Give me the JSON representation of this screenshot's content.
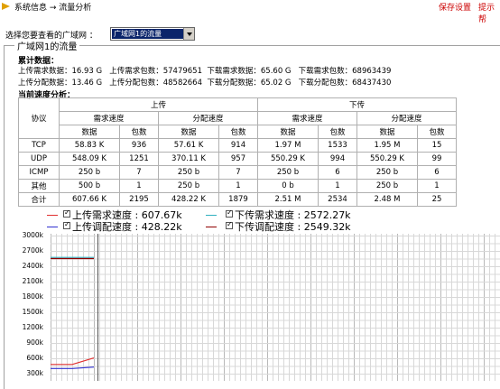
{
  "header": {
    "breadcrumb": "系统信息 → 流量分析",
    "save_label": "保存设置",
    "tip_label": "提示帮"
  },
  "selector": {
    "label": "选择您要查看的广域网 ：",
    "value": "广域网1的流量"
  },
  "panel": {
    "legend": "广域网1的流量",
    "cumulative_title": "累计数据：",
    "cumulative_lines": [
      "上传需求数据：16.93 G   上传需求包数：57479651  下载需求数据：65.60 G   下载需求包数：68963439",
      "上传分配数据：13.46 G   上传分配包数：48582664  下载分配数据：65.02 G   下载分配包数：68437430"
    ],
    "current_title": "当前速度分析："
  },
  "table": {
    "col_protocol": "协议",
    "col_upload": "上传",
    "col_download": "下传",
    "col_demand": "需求速度",
    "col_alloc": "分配速度",
    "col_data": "数据",
    "col_packets": "包数",
    "rows": [
      {
        "proto": "TCP",
        "ud": "58.83 K",
        "up": "936",
        "ad": "57.61 K",
        "ap": "914",
        "dd": "1.97 M",
        "dp": "1533",
        "bd": "1.95 M",
        "bp": "15"
      },
      {
        "proto": "UDP",
        "ud": "548.09 K",
        "up": "1251",
        "ad": "370.11 K",
        "ap": "957",
        "dd": "550.29 K",
        "dp": "994",
        "bd": "550.29 K",
        "bp": "99"
      },
      {
        "proto": "ICMP",
        "ud": "250 b",
        "up": "7",
        "ad": "250 b",
        "ap": "7",
        "dd": "250 b",
        "dp": "6",
        "bd": "250 b",
        "bp": "6"
      },
      {
        "proto": "其他",
        "ud": "500 b",
        "up": "1",
        "ad": "250 b",
        "ap": "1",
        "dd": "0 b",
        "dp": "1",
        "bd": "250 b",
        "bp": "1"
      },
      {
        "proto": "合计",
        "ud": "607.66 K",
        "up": "2195",
        "ad": "428.22 K",
        "ap": "1879",
        "dd": "2.51 M",
        "dp": "2534",
        "bd": "2.48 M",
        "bp": "25"
      }
    ]
  },
  "chart_legend": [
    {
      "label": "上传需求速度 : 607.67k",
      "color": "#e03030"
    },
    {
      "label": "下传需求速度 : 2572.27k",
      "color": "#30b0c0"
    },
    {
      "label": "上传调配速度 : 428.22k",
      "color": "#3030d0"
    },
    {
      "label": "下传调配速度 : 2549.32k",
      "color": "#900000"
    }
  ],
  "chart_data": {
    "type": "line",
    "y_ticks": [
      "3000k",
      "2700k",
      "2400k",
      "2100k",
      "1800k",
      "1500k",
      "1200k",
      "900k",
      "600k",
      "300k"
    ],
    "ylim": [
      0,
      3000
    ],
    "grid": true,
    "series": [
      {
        "name": "上传需求速度",
        "color": "#e03030",
        "values": [
          480,
          480,
          607.67
        ]
      },
      {
        "name": "下传需求速度",
        "color": "#30b0c0",
        "values": [
          2572.27,
          2572.27,
          2572.27
        ]
      },
      {
        "name": "上传调配速度",
        "color": "#3030d0",
        "values": [
          400,
          400,
          428.22
        ]
      },
      {
        "name": "下传调配速度",
        "color": "#900000",
        "values": [
          2549.32,
          2549.32,
          2549.32
        ]
      }
    ]
  }
}
